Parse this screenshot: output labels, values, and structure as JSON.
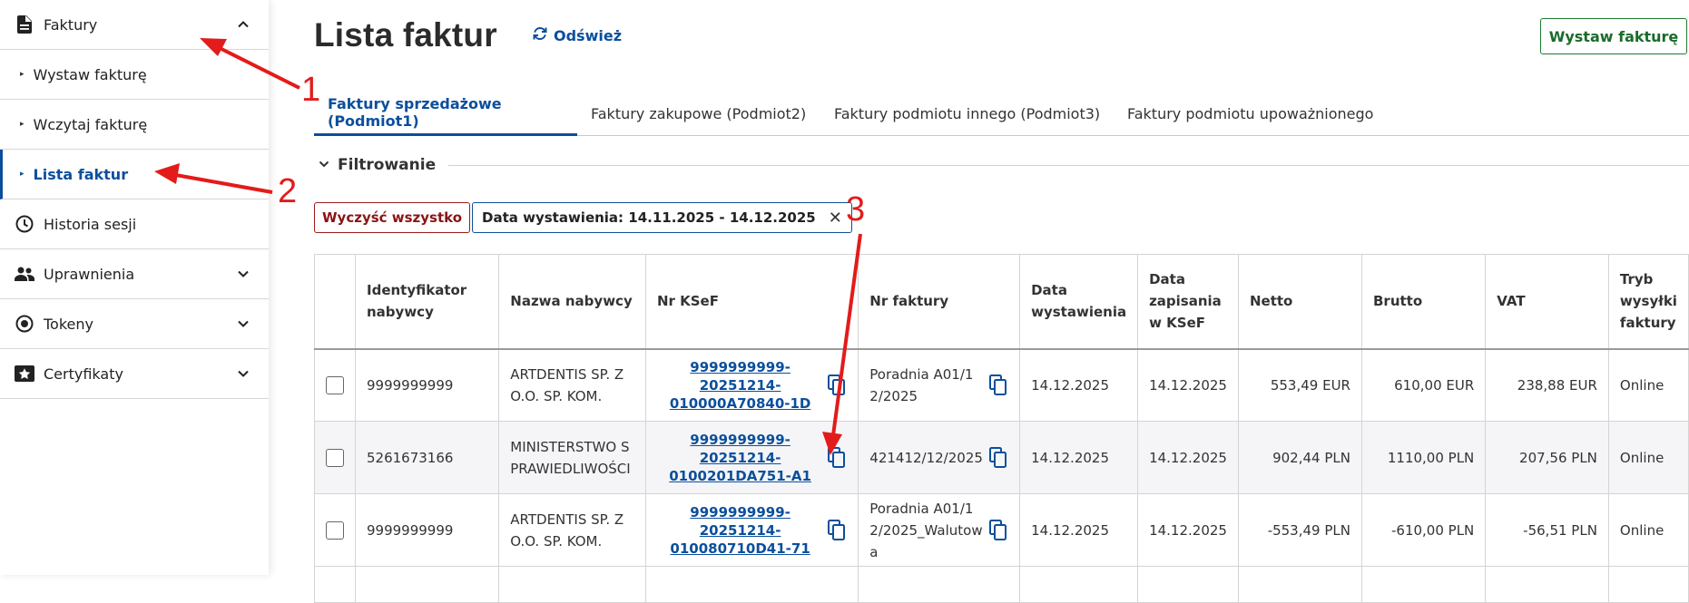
{
  "sidebar": {
    "faktury": "Faktury",
    "items": [
      {
        "label": "Wystaw fakturę"
      },
      {
        "label": "Wczytaj fakturę"
      },
      {
        "label": "Lista faktur"
      }
    ],
    "historia": "Historia sesji",
    "uprawnienia": "Uprawnienia",
    "tokeny": "Tokeny",
    "certyfikaty": "Certyfikaty"
  },
  "header": {
    "title": "Lista faktur",
    "refresh": "Odśwież",
    "issue_button": "Wystaw fakturę"
  },
  "tabs": [
    {
      "label": "Faktury sprzedażowe (Podmiot1)"
    },
    {
      "label": "Faktury zakupowe (Podmiot2)"
    },
    {
      "label": "Faktury podmiotu innego (Podmiot3)"
    },
    {
      "label": "Faktury podmiotu upoważnionego"
    }
  ],
  "filter": {
    "heading": "Filtrowanie",
    "clear_all": "Wyczyść wszystko",
    "chip": "Data wystawienia: 14.11.2025 - 14.12.2025"
  },
  "table": {
    "headers": {
      "buyer_id": "Identyfikator nabywcy",
      "buyer_name": "Nazwa nabywcy",
      "ksef": "Nr KSeF",
      "invoice_no": "Nr faktury",
      "issue_date": "Data wystawienia",
      "saved_date": "Data zapisania w KSeF",
      "net": "Netto",
      "gross": "Brutto",
      "vat": "VAT",
      "mode": "Tryb wysyłki faktury"
    },
    "rows": [
      {
        "buyer_id": "9999999999",
        "buyer_name": "ARTDENTIS SP. Z O.O. SP. KOM.",
        "ksef": "9999999999-20251214-010000A70840-1D",
        "invoice_no": "Poradnia A01/12/2025",
        "issue_date": "14.12.2025",
        "saved_date": "14.12.2025",
        "net": "553,49 EUR",
        "gross": "610,00 EUR",
        "vat": "238,88 EUR",
        "mode": "Online"
      },
      {
        "buyer_id": "5261673166",
        "buyer_name": "MINISTERSTWO S PRAWIEDLIWOŚCI",
        "ksef": "9999999999-20251214-0100201DA751-A1",
        "invoice_no": "421412/12/2025",
        "issue_date": "14.12.2025",
        "saved_date": "14.12.2025",
        "net": "902,44 PLN",
        "gross": "1110,00 PLN",
        "vat": "207,56 PLN",
        "mode": "Online"
      },
      {
        "buyer_id": "9999999999",
        "buyer_name": "ARTDENTIS SP. Z O.O. SP. KOM.",
        "ksef": "9999999999-20251214-010080710D41-71",
        "invoice_no": "Poradnia A01/12/2025_Walutowa",
        "issue_date": "14.12.2025",
        "saved_date": "14.12.2025",
        "net": "-553,49 PLN",
        "gross": "-610,00 PLN",
        "vat": "-56,51 PLN",
        "mode": "Online"
      }
    ]
  },
  "annotations": [
    "1",
    "2",
    "3"
  ],
  "colors": {
    "accent": "#0b4f9c",
    "issue_green": "#1e7b2f",
    "clear_red": "#9b1c1c",
    "annotation_red": "#e31b1b"
  }
}
